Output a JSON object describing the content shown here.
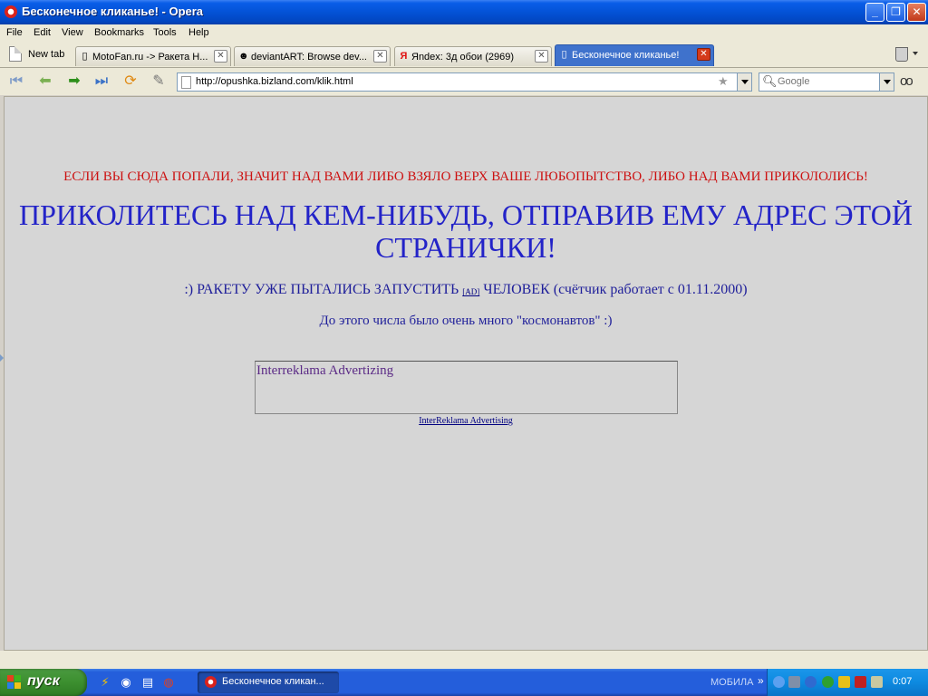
{
  "window": {
    "title": "Бесконечное кликанье! - Opera"
  },
  "menu": [
    "File",
    "Edit",
    "View",
    "Bookmarks",
    "Tools",
    "Help"
  ],
  "tabbar": {
    "new_tab_label": "New tab",
    "tabs": [
      {
        "label": "MotoFan.ru -> Ракета Н...",
        "icon": "page-icon",
        "active": false
      },
      {
        "label": "deviantART: Browse dev...",
        "icon": "deviantart-icon",
        "active": false
      },
      {
        "label": "Яndex: 3д обои (2969)",
        "icon": "yandex-icon",
        "active": false
      },
      {
        "label": "Бесконечное кликанье!",
        "icon": "page-icon",
        "active": true
      }
    ]
  },
  "navbar": {
    "url": "http://opushka.bizland.com/klik.html",
    "search_placeholder": "Google"
  },
  "page": {
    "line_red": "ЕСЛИ ВЫ СЮДА ПОПАЛИ, ЗНАЧИТ НАД ВАМИ ЛИБО ВЗЯЛО ВЕРХ ВАШЕ ЛЮБОПЫТСТВО, ЛИБО НАД ВАМИ ПРИКОЛОЛИСЬ!",
    "line_big": "ПРИКОЛИТЕСЬ НАД КЕМ-НИБУДЬ, ОТПРАВИВ ЕМУ АДРЕС ЭТОЙ СТРАНИЧКИ!",
    "counter_prefix": ":) РАКЕТУ УЖЕ ПЫТАЛИСЬ ЗАПУСТИТЬ",
    "counter_link": "[AD]",
    "counter_suffix": "ЧЕЛОВЕК (счётчик работает с 01.11.2000)",
    "cosmonauts_line": "До этого числа было очень много \"космонавтов\" :)",
    "ad_box_text": "Interreklama Advertizing",
    "ad_link": "InterReklama Advertising"
  },
  "taskbar": {
    "start_label": "пуск",
    "task_label": "Бесконечное кликан...",
    "tray_label": "МОБИЛА",
    "clock": "0:07"
  },
  "colors": {
    "red_text": "#cc1111",
    "blue_text": "#2323c8",
    "page_bg": "#d6d6d6"
  }
}
